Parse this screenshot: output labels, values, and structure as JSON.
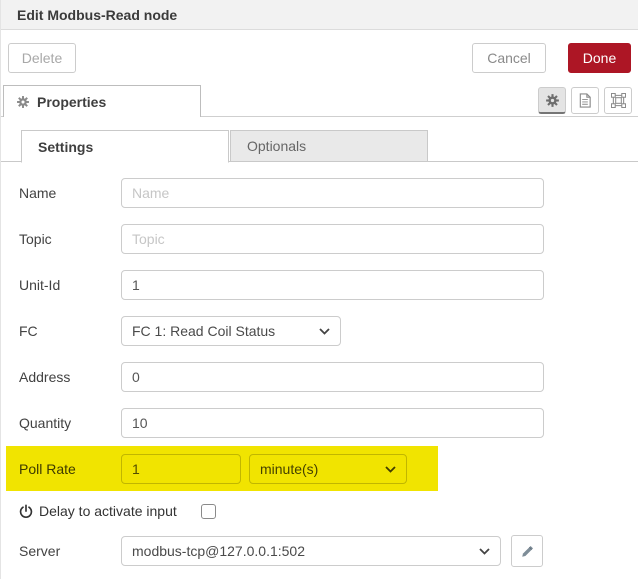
{
  "dialog": {
    "title": "Edit Modbus-Read node"
  },
  "toolbar": {
    "delete_label": "Delete",
    "cancel_label": "Cancel",
    "done_label": "Done"
  },
  "properties_bar": {
    "tab_label": "Properties",
    "icon_buttons": [
      "gear-icon",
      "description-icon",
      "appearance-icon"
    ],
    "active_icon": "gear-icon"
  },
  "form_tabs": {
    "settings_label": "Settings",
    "optionals_label": "Optionals",
    "active": "Settings"
  },
  "fields": {
    "name": {
      "label": "Name",
      "placeholder": "Name",
      "value": ""
    },
    "topic": {
      "label": "Topic",
      "placeholder": "Topic",
      "value": ""
    },
    "unit_id": {
      "label": "Unit-Id",
      "value": "1"
    },
    "fc": {
      "label": "FC",
      "value": "FC 1: Read Coil Status"
    },
    "address": {
      "label": "Address",
      "value": "0"
    },
    "quantity": {
      "label": "Quantity",
      "value": "10"
    },
    "poll_rate": {
      "label": "Poll Rate",
      "value": "1",
      "unit_value": "minute(s)"
    },
    "delay": {
      "label": "Delay to activate input",
      "checked": false
    },
    "server": {
      "label": "Server",
      "value": "modbus-tcp@127.0.0.1:502"
    }
  },
  "colors": {
    "done_red": "#AD1625",
    "highlight_yellow": "#f1e400",
    "header_bg": "#f2f2f2"
  }
}
